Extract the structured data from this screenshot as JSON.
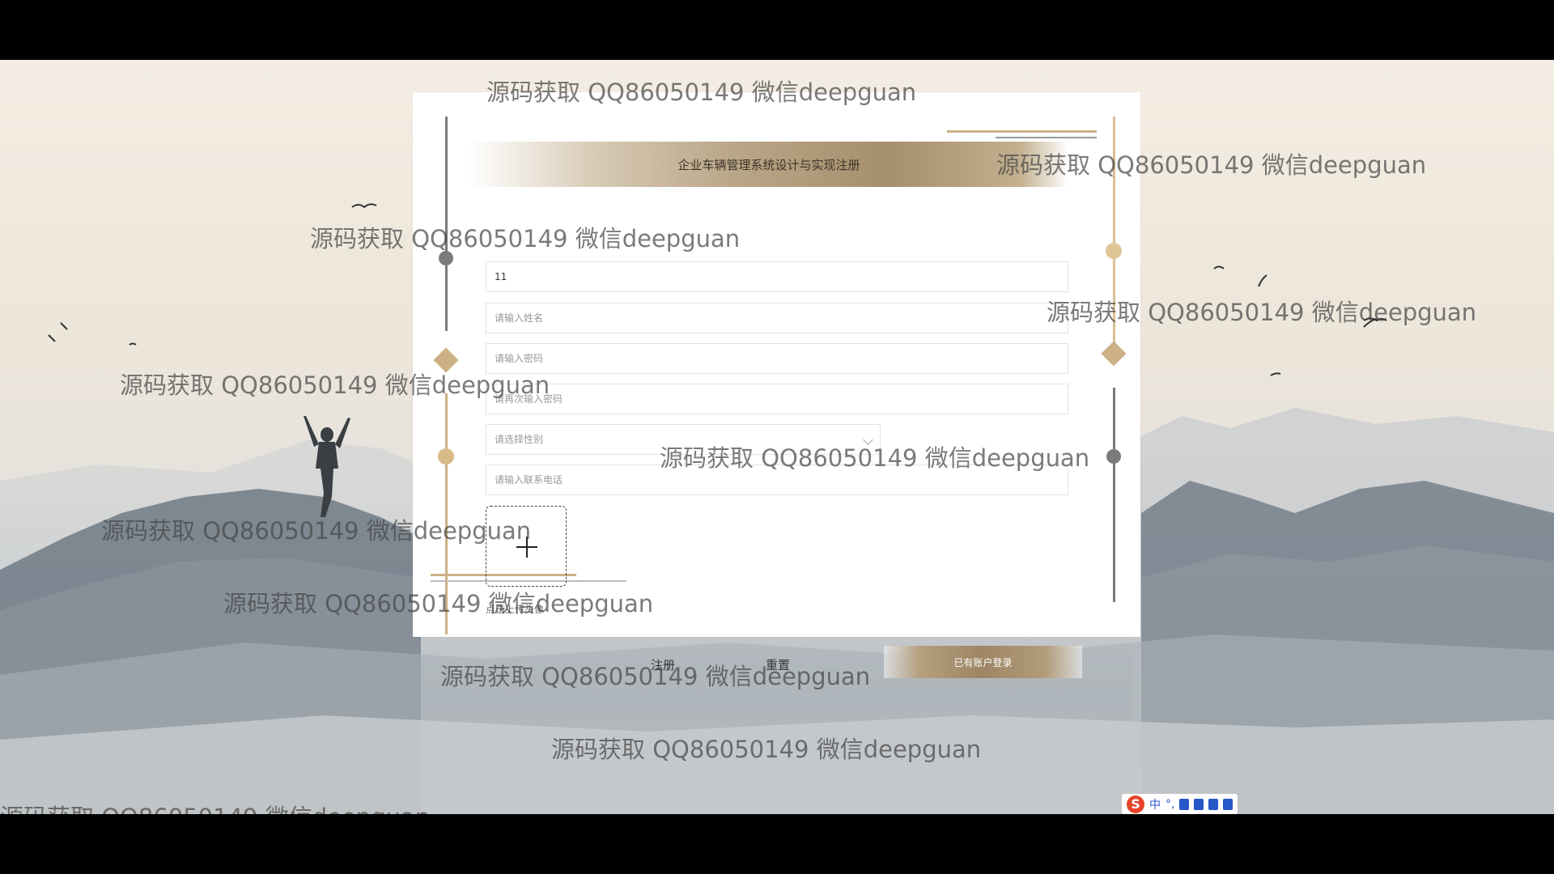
{
  "form": {
    "title": "企业车辆管理系统设计与实现注册",
    "username_value": "11",
    "name_placeholder": "请输入姓名",
    "password_placeholder": "请输入密码",
    "repassword_placeholder": "请再次输入密码",
    "gender_selected": "请选择性别",
    "phone_placeholder": "请输入联系电话",
    "avatar_tip": "点击上传头像",
    "register_label": "注册",
    "reset_label": "重置",
    "login_label": "已有账户登录"
  },
  "watermark_text": "源码获取 QQ86050149 微信deepguan",
  "ime": {
    "lang": "中"
  },
  "colors": {
    "accent_gold": "#cdb086",
    "accent_brown": "#9d8565",
    "deco_gray": "#7b7b7b"
  }
}
